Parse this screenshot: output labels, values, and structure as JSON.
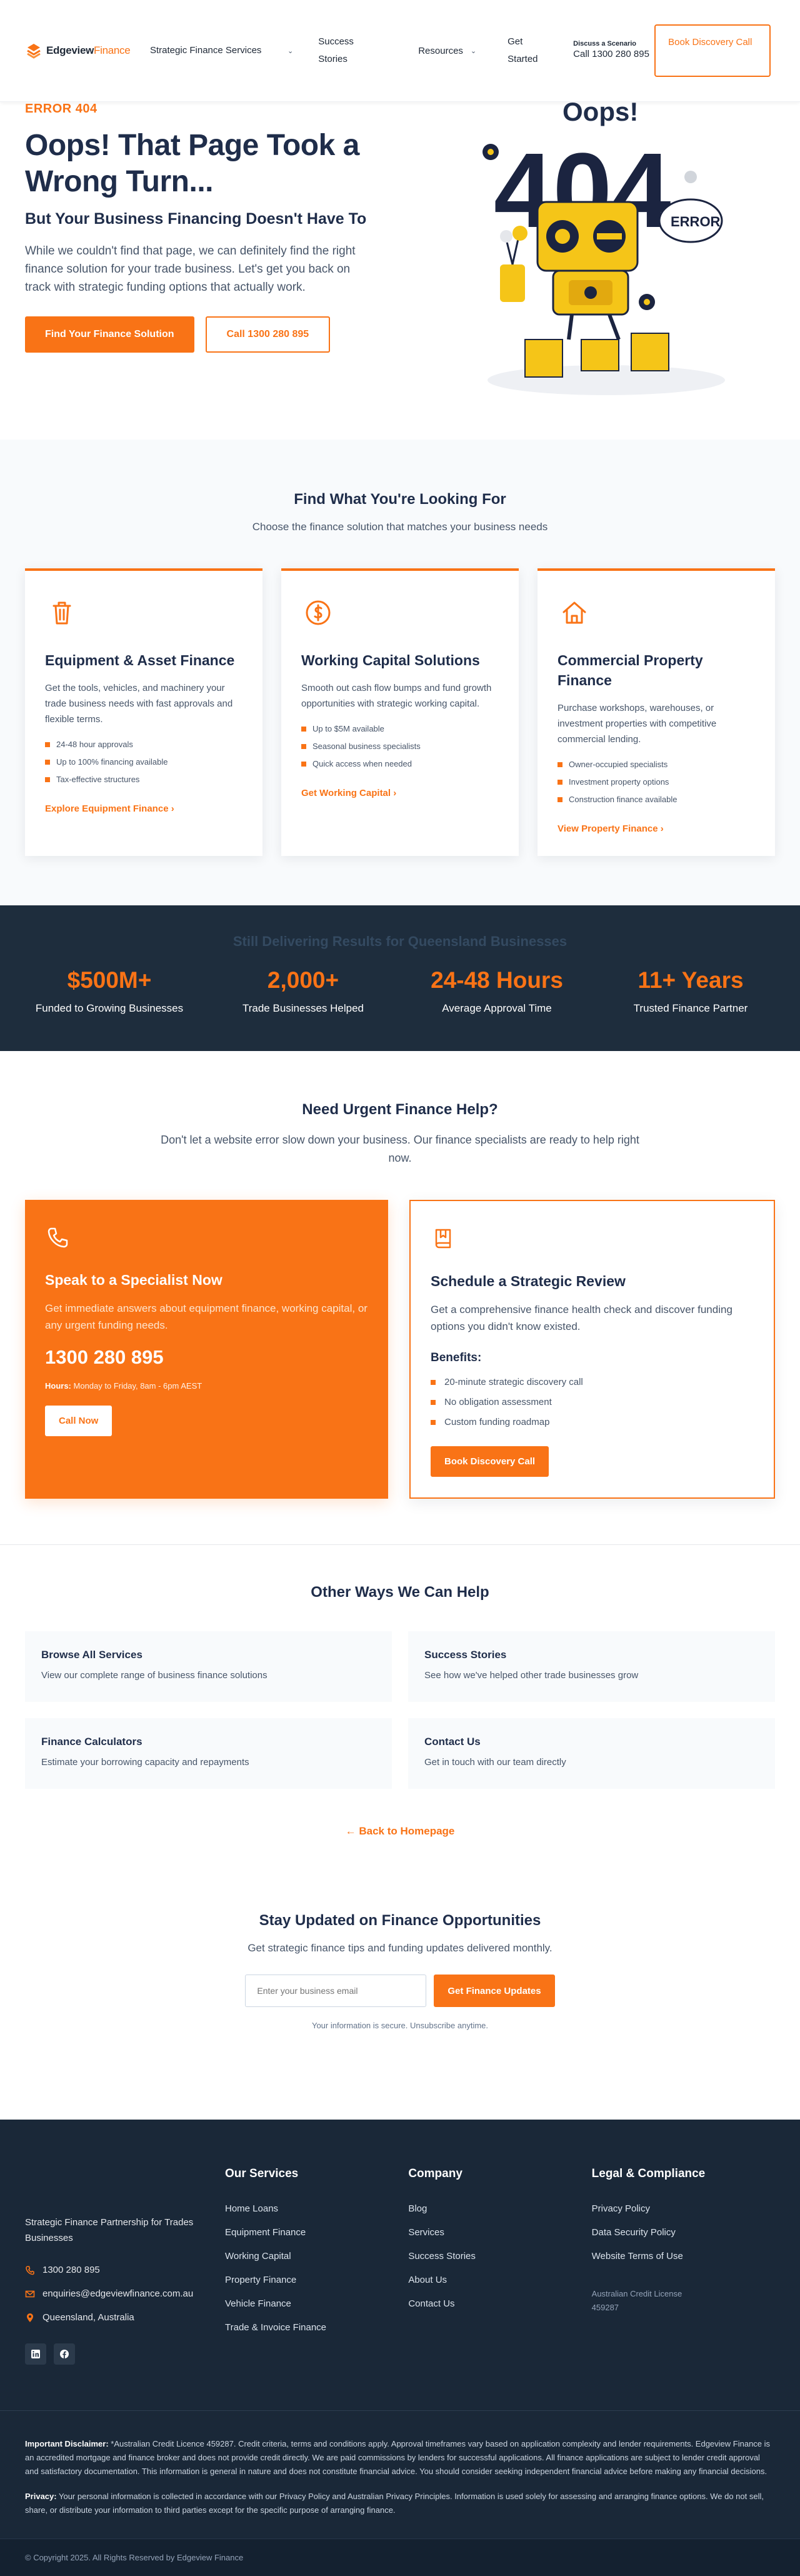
{
  "brand": {
    "name_bold": "Edgeview",
    "name_light": "Finance"
  },
  "nav": {
    "strategic_finance": "Strategic Finance Services",
    "success_stories": "Success Stories",
    "resources": "Resources",
    "get_started": "Get Started",
    "discuss_label": "Discuss a Scenario",
    "discuss_phone": "Call 1300 280 895",
    "book_call": "Book Discovery Call"
  },
  "hero": {
    "error_label": "ERROR 404",
    "title": "Oops! That Page Took a Wrong Turn...",
    "subtitle": "But Your Business Financing Doesn't Have To",
    "body": "While we couldn't find that page, we can definitely find the right finance solution for your trade business. Let's get you back on track with strategic funding options that actually work.",
    "btn_primary": "Find Your Finance Solution",
    "btn_secondary": "Call 1300 280 895",
    "art_oops": "Oops!",
    "art_404": "404",
    "art_error": "ERROR"
  },
  "find": {
    "title": "Find What You're Looking For",
    "subtitle": "Choose the finance solution that matches your business needs",
    "cards": [
      {
        "title": "Equipment & Asset Finance",
        "body": "Get the tools, vehicles, and machinery your trade business needs with fast approvals and flexible terms.",
        "bullets": [
          "24-48 hour approvals",
          "Up to 100% financing available",
          "Tax-effective structures"
        ],
        "link": "Explore Equipment Finance"
      },
      {
        "title": "Working Capital Solutions",
        "body": "Smooth out cash flow bumps and fund growth opportunities with strategic working capital.",
        "bullets": [
          "Up to $5M available",
          "Seasonal business specialists",
          "Quick access when needed"
        ],
        "link": "Get Working Capital"
      },
      {
        "title": "Commercial Property Finance",
        "body": "Purchase workshops, warehouses, or investment properties with competitive commercial lending.",
        "bullets": [
          "Owner-occupied specialists",
          "Investment property options",
          "Construction finance available"
        ],
        "link": "View Property Finance"
      }
    ]
  },
  "stats": {
    "title": "Still Delivering Results for Queensland Businesses",
    "items": [
      {
        "value": "$500M+",
        "label": "Funded to Growing Businesses"
      },
      {
        "value": "2,000+",
        "label": "Trade Businesses Helped"
      },
      {
        "value": "24-48 Hours",
        "label": "Average Approval Time"
      },
      {
        "value": "11+ Years",
        "label": "Trusted Finance Partner"
      }
    ]
  },
  "urgent": {
    "title": "Need Urgent Finance Help?",
    "subtitle": "Don't let a website error slow down your business. Our finance specialists are ready to help right now.",
    "specialist": {
      "title": "Speak to a Specialist Now",
      "body": "Get immediate answers about equipment finance, working capital, or any urgent funding needs.",
      "phone": "1300 280 895",
      "hours_label": "Hours:",
      "hours_value": "Monday to Friday, 8am - 6pm AEST",
      "btn": "Call Now"
    },
    "review": {
      "title": "Schedule a Strategic Review",
      "body": "Get a comprehensive finance health check and discover funding options you didn't know existed.",
      "benefits_label": "Benefits:",
      "benefits": [
        "20-minute strategic discovery call",
        "No obligation assessment",
        "Custom funding roadmap"
      ],
      "btn": "Book Discovery Call"
    }
  },
  "other": {
    "title": "Other Ways We Can Help",
    "items": [
      {
        "title": "Browse All Services",
        "desc": "View our complete range of business finance solutions"
      },
      {
        "title": "Success Stories",
        "desc": "See how we've helped other trade businesses grow"
      },
      {
        "title": "Finance Calculators",
        "desc": "Estimate your borrowing capacity and repayments"
      },
      {
        "title": "Contact Us",
        "desc": "Get in touch with our team directly"
      }
    ],
    "back": "Back to Homepage"
  },
  "newsletter": {
    "title": "Stay Updated on Finance Opportunities",
    "subtitle": "Get strategic finance tips and funding updates delivered monthly.",
    "placeholder": "Enter your business email",
    "btn": "Get Finance Updates",
    "note": "Your information is secure. Unsubscribe anytime."
  },
  "footer": {
    "tagline": "Strategic Finance Partnership for Trades Businesses",
    "phone": "1300 280 895",
    "email": "enquiries@edgeviewfinance.com.au",
    "location": "Queensland, Australia",
    "services_head": "Our Services",
    "services": [
      "Home Loans",
      "Equipment Finance",
      "Working Capital",
      "Property Finance",
      "Vehicle Finance",
      "Trade & Invoice Finance"
    ],
    "company_head": "Company",
    "company": [
      "Blog",
      "Services",
      "Success Stories",
      "About Us",
      "Contact Us"
    ],
    "legal_head": "Legal & Compliance",
    "legal": [
      "Privacy Policy",
      "Data Security Policy",
      "Website Terms of Use"
    ],
    "licence": "Australian Credit License 459287",
    "disclaimer_label": "Important Disclaimer:",
    "disclaimer": "*Australian Credit Licence 459287. Credit criteria, terms and conditions apply. Approval timeframes vary based on application complexity and lender requirements. Edgeview Finance is an accredited mortgage and finance broker and does not provide credit directly. We are paid commissions by lenders for successful applications. All finance applications are subject to lender credit approval and satisfactory documentation. This information is general in nature and does not constitute financial advice. You should consider seeking independent financial advice before making any financial decisions.",
    "privacy_label": "Privacy:",
    "privacy": "Your personal information is collected in accordance with our Privacy Policy and Australian Privacy Principles. Information is used solely for assessing and arranging finance options. We do not sell, share, or distribute your information to third parties except for the specific purpose of arranging finance.",
    "copyright": "© Copyright 2025. All Rights Reserved by Edgeview Finance"
  },
  "colors": {
    "accent": "#f97316",
    "navy": "#1f2d4a",
    "dark": "#1a2838"
  }
}
